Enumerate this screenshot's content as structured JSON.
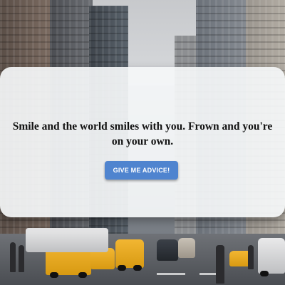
{
  "quote": {
    "text": "Smile and the world smiles with you. Frown and you're on your own."
  },
  "actions": {
    "advice_button_label": "GIVE ME ADVICE!"
  },
  "colors": {
    "button_bg": "#4f84cf",
    "card_bg": "#f5f7f9"
  }
}
